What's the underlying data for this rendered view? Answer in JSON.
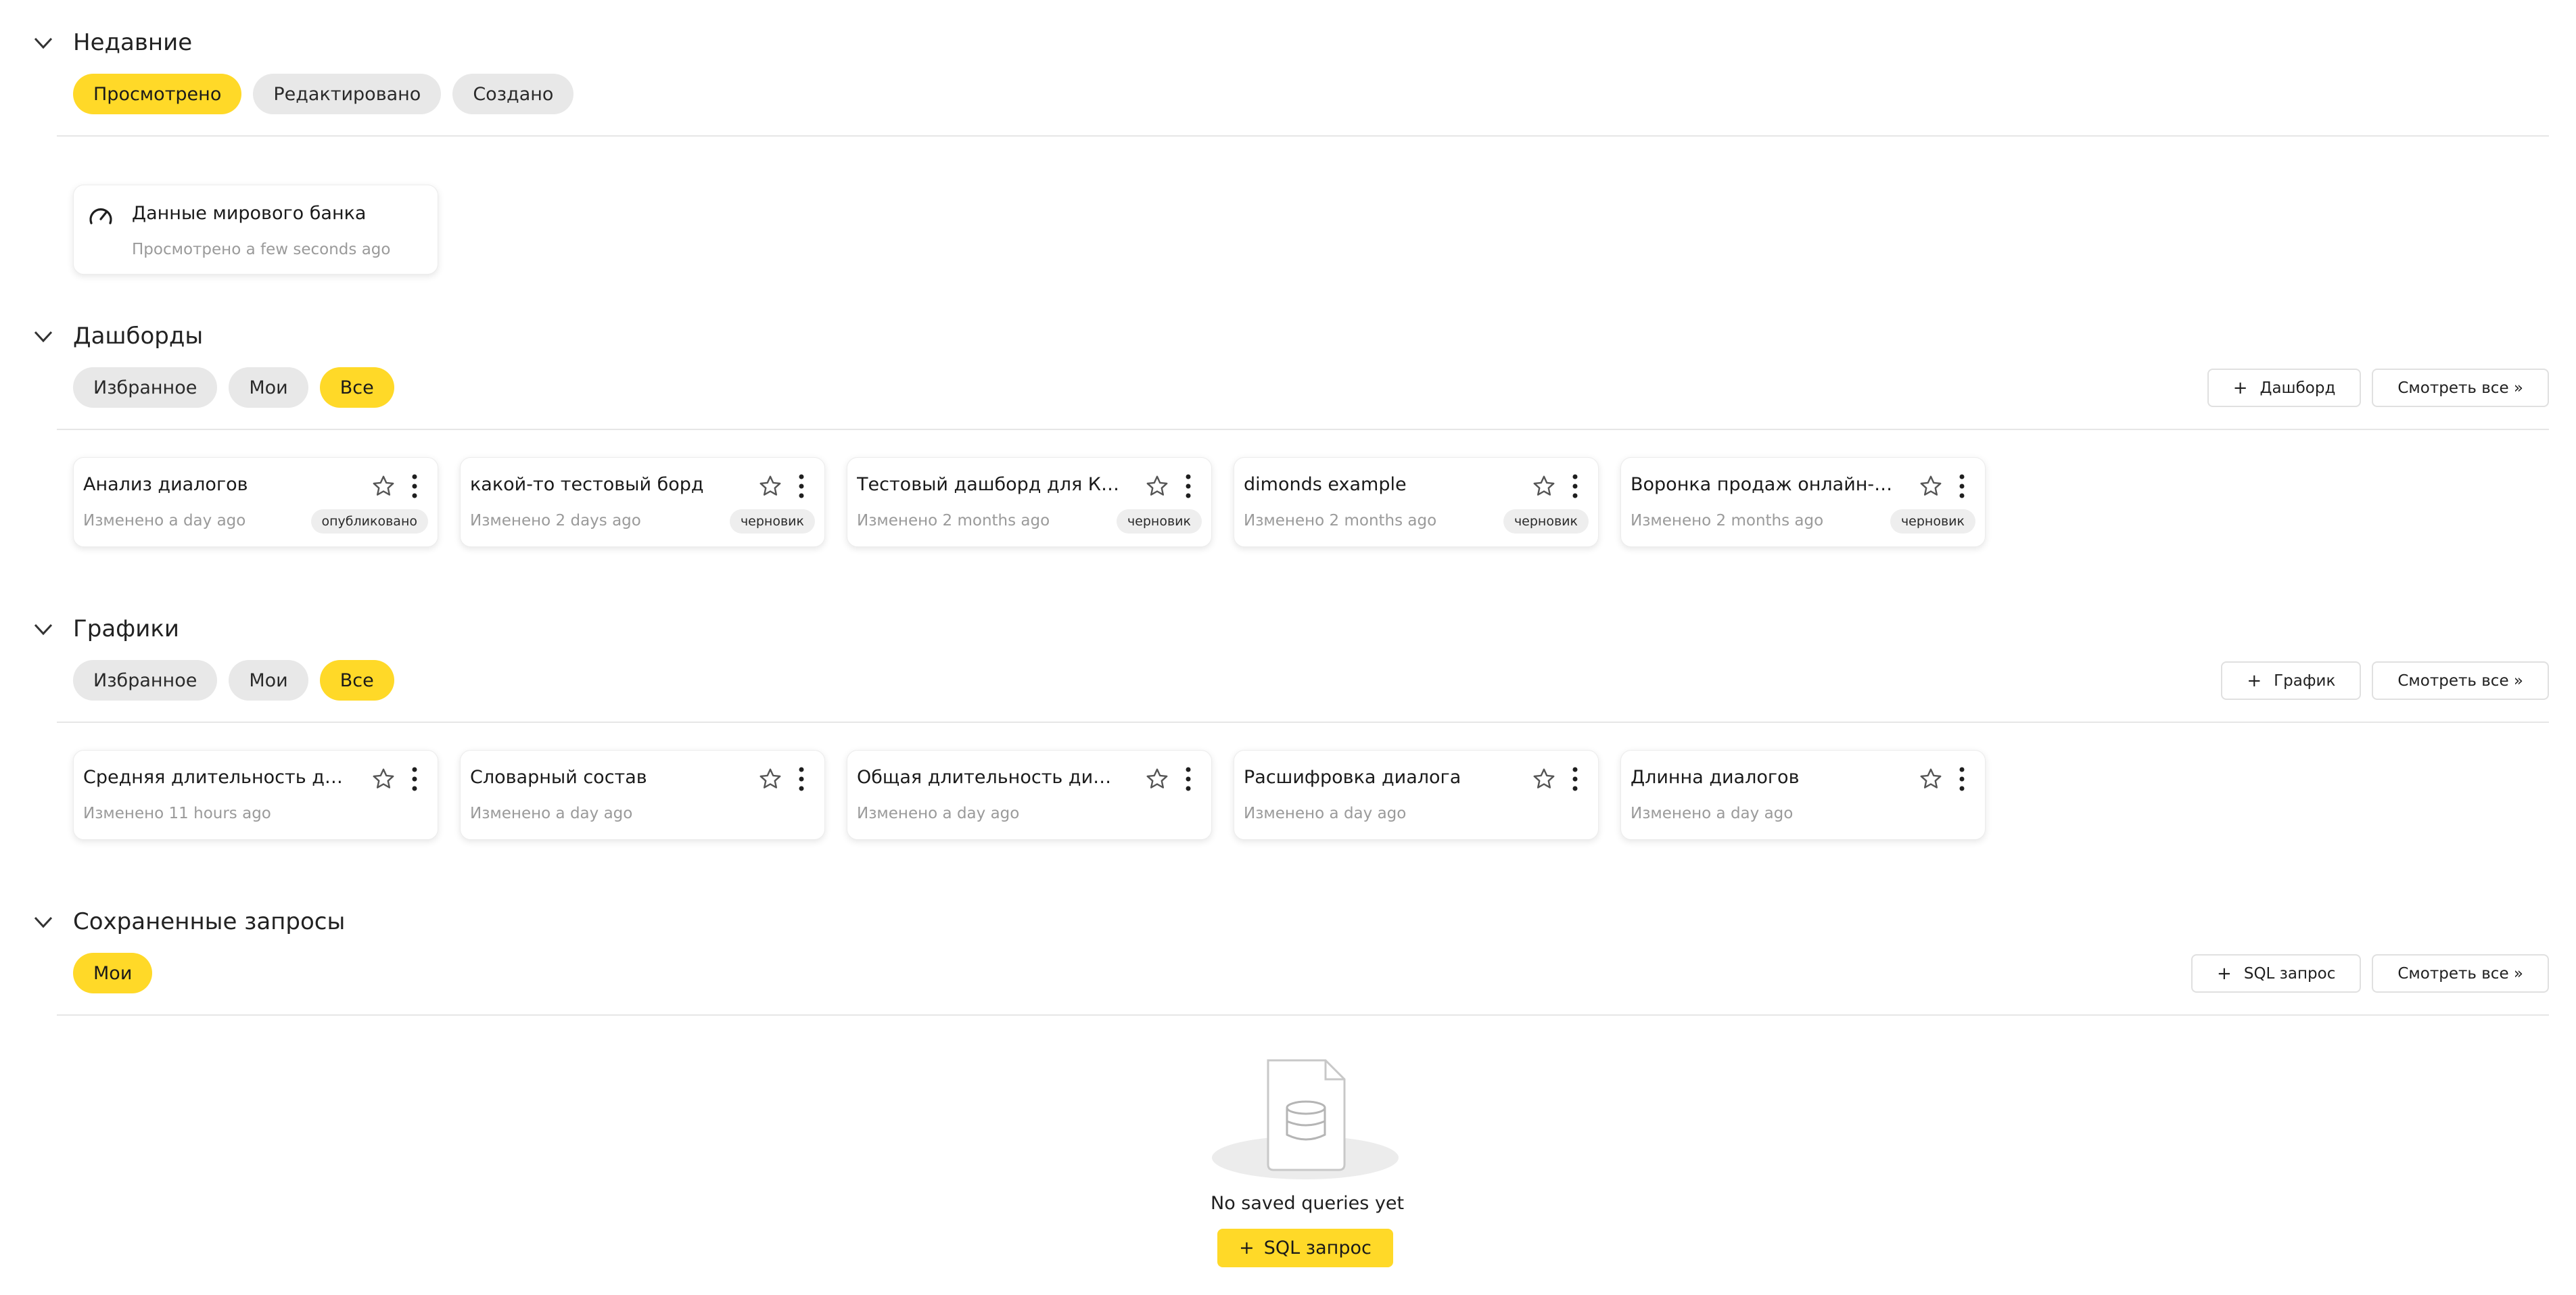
{
  "recent": {
    "title": "Недавние",
    "tabs": [
      "Просмотрено",
      "Редактировано",
      "Создано"
    ],
    "items": [
      {
        "title": "Данные мирового банка",
        "subtitle": "Просмотрено a few seconds ago",
        "icon": "gauge-icon"
      }
    ]
  },
  "dashboards": {
    "title": "Дашборды",
    "tabs": [
      "Избранное",
      "Мои",
      "Все"
    ],
    "add_label": "Дашборд",
    "view_all_label": "Смотреть все »",
    "items": [
      {
        "title": "Анализ диалогов",
        "subtitle": "Изменено a day ago",
        "badge": "опубликовано"
      },
      {
        "title": "какой-то тестовый борд",
        "subtitle": "Изменено 2 days ago",
        "badge": "черновик"
      },
      {
        "title": "Тестовый дашборд для КСК",
        "subtitle": "Изменено 2 months ago",
        "badge": "черновик"
      },
      {
        "title": "dimonds example",
        "subtitle": "Изменено 2 months ago",
        "badge": "черновик"
      },
      {
        "title": "Воронка продаж онлайн-шко...",
        "subtitle": "Изменено 2 months ago",
        "badge": "черновик"
      }
    ]
  },
  "charts": {
    "title": "Графики",
    "tabs": [
      "Избранное",
      "Мои",
      "Все"
    ],
    "add_label": "График",
    "view_all_label": "Смотреть все »",
    "items": [
      {
        "title": "Средняя длительность диал...",
        "subtitle": "Изменено 11 hours ago"
      },
      {
        "title": "Словарный состав",
        "subtitle": "Изменено a day ago"
      },
      {
        "title": "Общая длительность диалог...",
        "subtitle": "Изменено a day ago"
      },
      {
        "title": "Расшифровка диалога",
        "subtitle": "Изменено a day ago"
      },
      {
        "title": "Длинна диалогов",
        "subtitle": "Изменено a day ago"
      }
    ]
  },
  "saved_queries": {
    "title": "Сохраненные запросы",
    "tabs": [
      "Мои"
    ],
    "add_label": "SQL запрос",
    "view_all_label": "Смотреть все »",
    "empty_text": "No saved queries yet",
    "empty_button_label": "SQL запрос"
  },
  "colors": {
    "accent": "#ffd928",
    "pill_bg": "#e8e8e8",
    "muted_text": "#9a9a9a"
  }
}
